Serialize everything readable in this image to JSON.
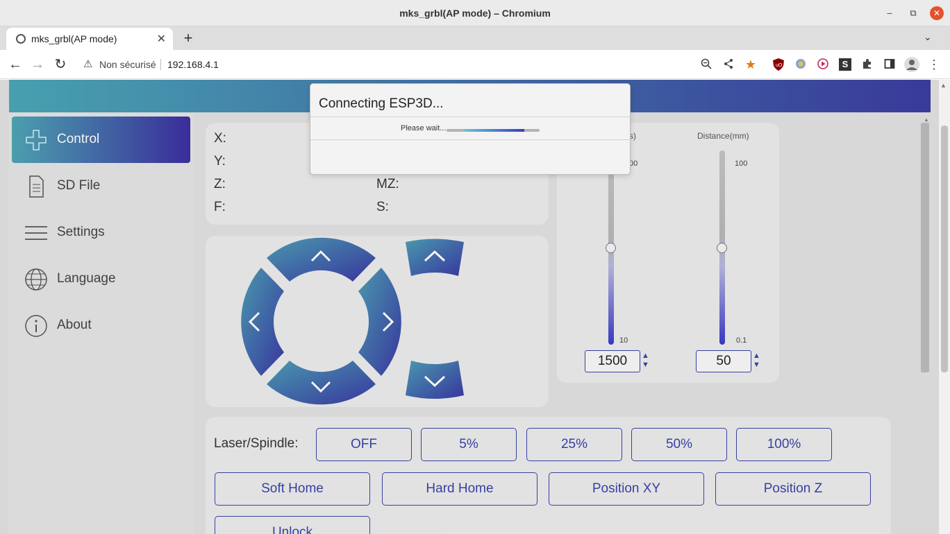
{
  "window": {
    "title": "mks_grbl(AP mode) – Chromium",
    "minimize": "–",
    "restore": "⧉",
    "close": "✕"
  },
  "tab": {
    "title": "mks_grbl(AP mode)",
    "close": "✕",
    "new_tab": "+",
    "tab_list": "⌄"
  },
  "toolbar": {
    "back": "←",
    "forward": "→",
    "reload": "↻",
    "security_icon": "⚠",
    "security_text": "Non sécurisé",
    "url": "192.168.4.1",
    "icons": [
      "zoom-out-icon",
      "share-icon",
      "bookmark-star-icon",
      "ublock-icon",
      "extension-icon",
      "media-icon",
      "s-extension-icon",
      "puzzle-icon",
      "sidepanel-icon",
      "profile-icon",
      "menu-icon"
    ]
  },
  "sidebar": {
    "items": [
      {
        "label": "Control",
        "icon": "gamepad-icon",
        "active": true
      },
      {
        "label": "SD File",
        "icon": "file-icon",
        "active": false
      },
      {
        "label": "Settings",
        "icon": "menu-lines-icon",
        "active": false
      },
      {
        "label": "Language",
        "icon": "globe-icon",
        "active": false
      },
      {
        "label": "About",
        "icon": "info-icon",
        "active": false
      }
    ]
  },
  "coords": {
    "x": "X:",
    "y": "Y:",
    "z": "Z:",
    "f": "F:",
    "mz": "MZ:",
    "s": "S:"
  },
  "sliders": {
    "speed": {
      "title_visible": "s)",
      "max_visible": "00",
      "min": "10",
      "value": "1500"
    },
    "distance": {
      "title": "Distance(mm)",
      "max": "100",
      "min": "0.1",
      "value": "50"
    }
  },
  "laser": {
    "label": "Laser/Spindle:",
    "buttons": [
      "OFF",
      "5%",
      "25%",
      "50%",
      "100%"
    ]
  },
  "actions": {
    "buttons": [
      "Soft Home",
      "Hard Home",
      "Position XY",
      "Position Z"
    ],
    "unlock": "Unlock"
  },
  "dialog": {
    "title": "Connecting ESP3D...",
    "wait_text": "Please wait...",
    "progress": 0.8
  },
  "colors": {
    "accent": "#3a43a8",
    "gradient_start": "#4fa6b5",
    "gradient_end": "#3c2fa0"
  }
}
